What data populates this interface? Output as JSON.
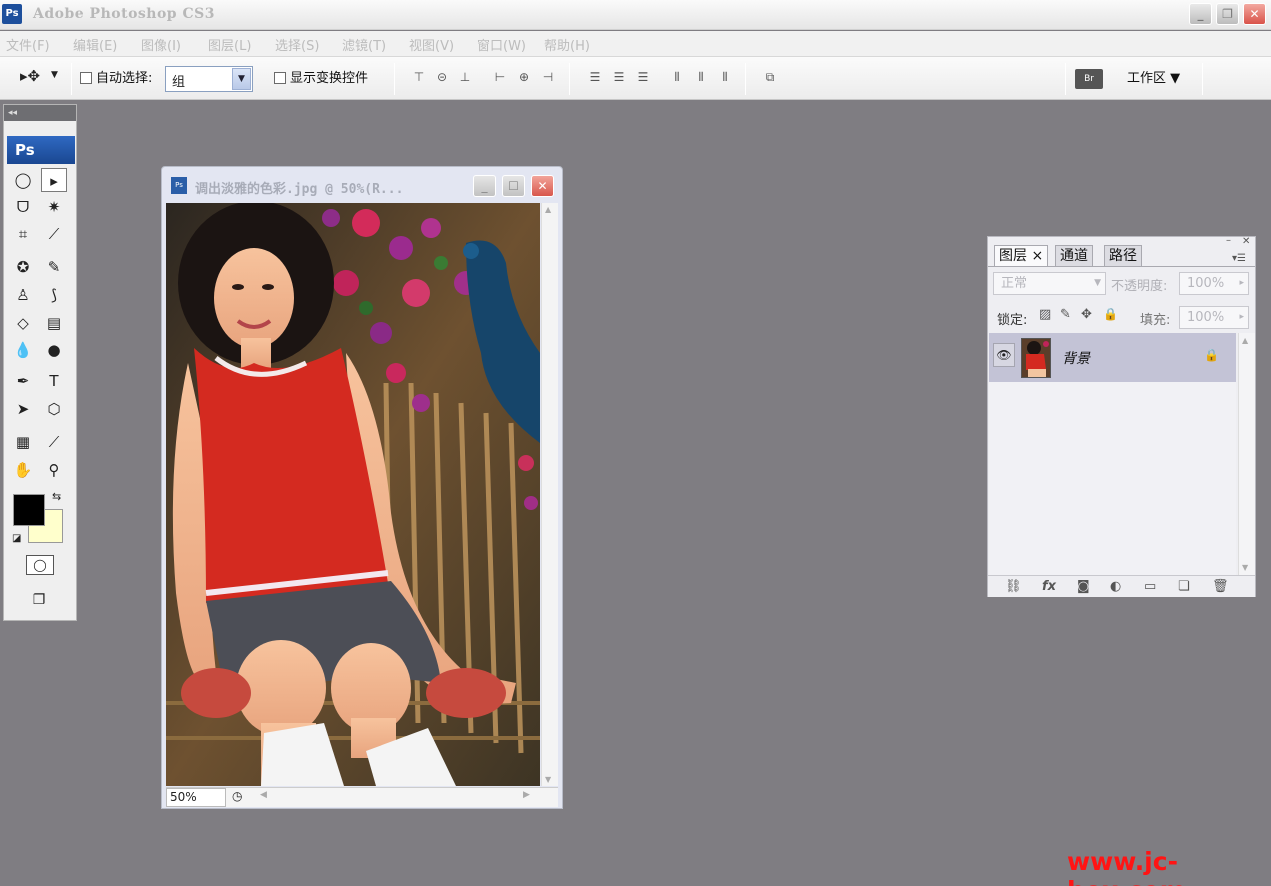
{
  "window": {
    "title": "Adobe Photoshop CS3",
    "app_icon": "Ps",
    "min": "_",
    "max": "❐",
    "close": "✕"
  },
  "menu": [
    {
      "label": "文件(F)"
    },
    {
      "label": "编辑(E)"
    },
    {
      "label": "图像(I)"
    },
    {
      "label": "图层(L)"
    },
    {
      "label": "选择(S)"
    },
    {
      "label": "滤镜(T)"
    },
    {
      "label": "视图(V)"
    },
    {
      "label": "窗口(W)"
    },
    {
      "label": "帮助(H)"
    }
  ],
  "options": {
    "tool_glyph": "▸✥",
    "auto_select_label": "自动选择:",
    "auto_select_value": "组",
    "show_transform_label": "显示变换控件",
    "workspace_label": "工作区 ▼",
    "bridge_icon": "Br"
  },
  "toolbox": {
    "collapse": "◂◂",
    "badge": "Ps"
  },
  "document": {
    "title": "调出淡雅的色彩.jpg @ 50%(R...",
    "icon": "Ps",
    "zoom": "50%"
  },
  "layers_panel": {
    "tabs": [
      {
        "label": "图层 ×"
      },
      {
        "label": "通道"
      },
      {
        "label": "路径"
      }
    ],
    "blend_mode": "正常",
    "opacity_label": "不透明度:",
    "opacity_value": "100%",
    "lock_label": "锁定:",
    "fill_label": "填充:",
    "fill_value": "100%",
    "layer_name": "背景",
    "footer_fx": "fx"
  },
  "watermark": "www.jc-box.com",
  "colors": {
    "accent": "#1d4f9c",
    "canvas_bg": "#7f7d82",
    "foreground": "#000000",
    "background": "#ffffcc",
    "watermark": "#ff1414"
  }
}
